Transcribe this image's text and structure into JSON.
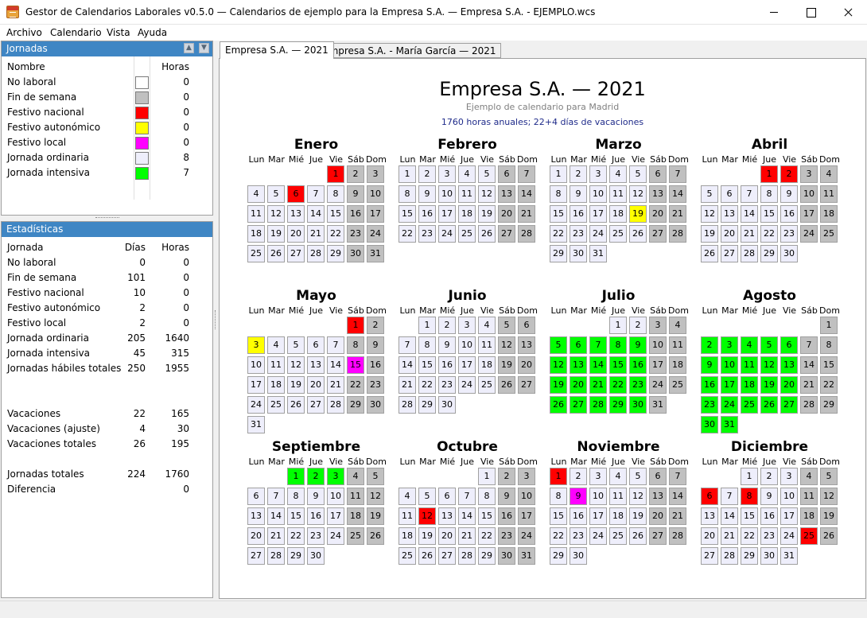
{
  "window": {
    "title": "Gestor de Calendarios Laborales v0.5.0 — Calendarios de ejemplo para la Empresa S.A. — Empresa S.A. - EJEMPLO.wcs"
  },
  "menu": [
    "Archivo",
    "Calendario",
    "Vista",
    "Ayuda"
  ],
  "jornadas": {
    "header": "Jornadas",
    "col_name": "Nombre",
    "col_hours": "Horas",
    "rows": [
      {
        "name": "No laboral",
        "color": "#ffffff",
        "hours": "0"
      },
      {
        "name": "Fin de semana",
        "color": "#c0c0c0",
        "hours": "0"
      },
      {
        "name": "Festivo nacional",
        "color": "#ff0000",
        "hours": "0"
      },
      {
        "name": "Festivo autonómico",
        "color": "#ffff00",
        "hours": "0"
      },
      {
        "name": "Festivo local",
        "color": "#ff00ff",
        "hours": "0"
      },
      {
        "name": "Jornada ordinaria",
        "color": "#eeeefb",
        "hours": "8"
      },
      {
        "name": "Jornada intensiva",
        "color": "#00ff00",
        "hours": "7"
      }
    ]
  },
  "estadisticas": {
    "header": "Estadísticas",
    "col_name": "Jornada",
    "col_days": "Días",
    "col_hours": "Horas",
    "rows": [
      {
        "name": "No laboral",
        "days": "0",
        "hours": "0"
      },
      {
        "name": "Fin de semana",
        "days": "101",
        "hours": "0"
      },
      {
        "name": "Festivo nacional",
        "days": "10",
        "hours": "0"
      },
      {
        "name": "Festivo autonómico",
        "days": "2",
        "hours": "0"
      },
      {
        "name": "Festivo local",
        "days": "2",
        "hours": "0"
      },
      {
        "name": "Jornada ordinaria",
        "days": "205",
        "hours": "1640"
      },
      {
        "name": "Jornada intensiva",
        "days": "45",
        "hours": "315"
      },
      {
        "name": "Jornadas hábiles totales",
        "days": "250",
        "hours": "1955"
      },
      {
        "name": "Vacaciones",
        "days": "22",
        "hours": "165"
      },
      {
        "name": "Vacaciones (ajuste)",
        "days": "4",
        "hours": "30"
      },
      {
        "name": "Vacaciones totales",
        "days": "26",
        "hours": "195"
      },
      {
        "name": "Jornadas totales",
        "days": "224",
        "hours": "1760"
      },
      {
        "name": "Diferencia",
        "days": "",
        "hours": "0"
      }
    ]
  },
  "tabs": [
    "Empresa S.A. — 2021",
    "Empresa S.A. - María García — 2021"
  ],
  "calendar": {
    "title": "Empresa S.A. — 2021",
    "subtitle": "Ejemplo de calendario para Madrid",
    "summary": "1760 horas anuales; 22+4 días de vacaciones",
    "weekdays": [
      "Lun",
      "Mar",
      "Mié",
      "Jue",
      "Vie",
      "Sáb",
      "Dom"
    ],
    "colors": {
      "ordinaria": "#eeeefb",
      "weekend": "#c0c0c0",
      "nacional": "#ff0000",
      "autonomico": "#ffff00",
      "local": "#ff00ff",
      "intensiva": "#00ff00"
    },
    "months": [
      {
        "name": "Enero",
        "start": 4,
        "days": 31,
        "nacional": [
          1
        ],
        "intensiva": [],
        "autonomico": [],
        "local": [],
        "red_text": [
          6
        ]
      },
      {
        "name": "Febrero",
        "start": 0,
        "days": 28,
        "nacional": [],
        "intensiva": [],
        "autonomico": [],
        "local": []
      },
      {
        "name": "Marzo",
        "start": 0,
        "days": 31,
        "nacional": [],
        "intensiva": [],
        "autonomico": [
          19
        ],
        "local": []
      },
      {
        "name": "Abril",
        "start": 3,
        "days": 30,
        "nacional": [
          1,
          2
        ],
        "intensiva": [],
        "autonomico": [],
        "local": []
      },
      {
        "name": "Mayo",
        "start": 5,
        "days": 31,
        "nacional": [
          1
        ],
        "intensiva": [],
        "autonomico": [
          3
        ],
        "local": [
          15
        ]
      },
      {
        "name": "Junio",
        "start": 1,
        "days": 30,
        "nacional": [],
        "intensiva": [],
        "autonomico": [],
        "local": []
      },
      {
        "name": "Julio",
        "start": 3,
        "days": 31,
        "nacional": [],
        "intensiva": [
          5,
          6,
          7,
          8,
          9,
          12,
          13,
          14,
          15,
          16,
          19,
          20,
          21,
          22,
          23,
          26,
          27,
          28,
          29,
          30
        ],
        "autonomico": [],
        "local": []
      },
      {
        "name": "Agosto",
        "start": 6,
        "days": 31,
        "nacional": [],
        "intensiva": [
          2,
          3,
          4,
          5,
          6,
          9,
          10,
          11,
          12,
          13,
          16,
          17,
          18,
          19,
          20,
          23,
          24,
          25,
          26,
          27,
          30,
          31
        ],
        "autonomico": [],
        "local": []
      },
      {
        "name": "Septiembre",
        "start": 2,
        "days": 30,
        "nacional": [],
        "intensiva": [
          1,
          2,
          3
        ],
        "autonomico": [],
        "local": []
      },
      {
        "name": "Octubre",
        "start": 4,
        "days": 31,
        "nacional": [
          12
        ],
        "intensiva": [],
        "autonomico": [],
        "local": []
      },
      {
        "name": "Noviembre",
        "start": 0,
        "days": 30,
        "nacional": [
          1
        ],
        "intensiva": [],
        "autonomico": [],
        "local": [
          9
        ]
      },
      {
        "name": "Diciembre",
        "start": 2,
        "days": 31,
        "nacional": [
          6,
          8,
          25
        ],
        "intensiva": [],
        "autonomico": [],
        "local": []
      }
    ]
  }
}
